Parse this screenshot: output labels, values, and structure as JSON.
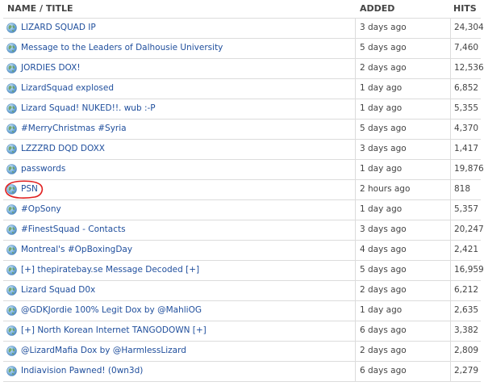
{
  "header": {
    "title_label": "NAME / TITLE",
    "added_label": "ADDED",
    "hits_label": "HITS"
  },
  "rows": [
    {
      "title": "LIZARD SQUAD IP",
      "added": "3 days ago",
      "hits": "24,304"
    },
    {
      "title": "Message to the Leaders of Dalhousie University",
      "added": "5 days ago",
      "hits": "7,460"
    },
    {
      "title": "JORDIES DOX!",
      "added": "2 days ago",
      "hits": "12,536"
    },
    {
      "title": "LizardSquad explosed",
      "added": "1 day ago",
      "hits": "6,852"
    },
    {
      "title": "Lizard Squad! NUKED!!. wub :-P",
      "added": "1 day ago",
      "hits": "5,355"
    },
    {
      "title": "#MerryChristmas #Syria",
      "added": "5 days ago",
      "hits": "4,370"
    },
    {
      "title": "LZZZRD DQD DOXX",
      "added": "3 days ago",
      "hits": "1,417"
    },
    {
      "title": "passwords",
      "added": "1 day ago",
      "hits": "19,876"
    },
    {
      "title": "PSN",
      "added": "2 hours ago",
      "hits": "818"
    },
    {
      "title": "#OpSony",
      "added": "1 day ago",
      "hits": "5,357"
    },
    {
      "title": "#FinestSquad - Contacts",
      "added": "3 days ago",
      "hits": "20,247"
    },
    {
      "title": "Montreal's #OpBoxingDay",
      "added": "4 days ago",
      "hits": "2,421"
    },
    {
      "title": "[+] thepiratebay.se Message Decoded [+]",
      "added": "5 days ago",
      "hits": "16,959"
    },
    {
      "title": "Lizard Squad D0x",
      "added": "2 days ago",
      "hits": "6,212"
    },
    {
      "title": "@GDKJordie 100% Legit Dox by @MahliOG",
      "added": "1 day ago",
      "hits": "2,635"
    },
    {
      "title": "[+] North Korean Internet TANGODOWN [+]",
      "added": "6 days ago",
      "hits": "3,382"
    },
    {
      "title": "@LizardMafia Dox by @HarmlessLizard",
      "added": "2 days ago",
      "hits": "2,809"
    },
    {
      "title": "Indiavision Pawned! (0wn3d)",
      "added": "6 days ago",
      "hits": "2,279"
    }
  ],
  "icons": {
    "row_icon": "globe-icon",
    "annotation": "red-circle-annotation"
  },
  "colors": {
    "link": "#1f4e9c",
    "annotation": "#e02020"
  }
}
